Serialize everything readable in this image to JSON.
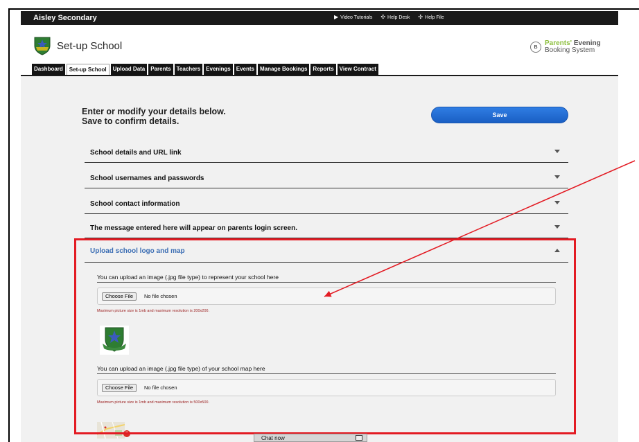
{
  "topbar": {
    "school_name": "Aisley Secondary",
    "links": [
      {
        "icon": "video-camera-icon",
        "label": "Video Tutorials"
      },
      {
        "icon": "help-desk-icon",
        "label": "Help Desk"
      },
      {
        "icon": "help-file-icon",
        "label": "Help File"
      }
    ]
  },
  "header": {
    "title": "Set-up School",
    "brand_line1_accent": "Parents'",
    "brand_line1_rest": "Evening",
    "brand_line2": "Booking System"
  },
  "tabs": [
    {
      "label": "Dashboard"
    },
    {
      "label": "Set-up School",
      "active": true
    },
    {
      "label": "Upload Data"
    },
    {
      "label": "Parents"
    },
    {
      "label": "Teachers"
    },
    {
      "label": "Evenings"
    },
    {
      "label": "Events"
    },
    {
      "label": "Manage Bookings"
    },
    {
      "label": "Reports"
    },
    {
      "label": "View Contract"
    }
  ],
  "intro": {
    "line1": "Enter or modify your details below.",
    "line2": "Save to confirm details."
  },
  "save_label": "Save",
  "accordion": [
    {
      "label": "School details and URL link",
      "expanded": false
    },
    {
      "label": "School usernames and passwords",
      "expanded": false
    },
    {
      "label": "School contact information",
      "expanded": false
    },
    {
      "label": "The message entered here will appear on parents login screen.",
      "expanded": false
    },
    {
      "label": "Upload school logo and map",
      "expanded": true
    }
  ],
  "upload": {
    "logo_label": "You can upload an image (.jpg file type) to represent your school here",
    "logo_choose": "Choose File",
    "logo_status": "No file chosen",
    "logo_note": "Maximum picture size is 1mb and maximum resolution is 200x200.",
    "map_label": "You can upload an image (.jpg file type) of your school map here",
    "map_choose": "Choose File",
    "map_status": "No file chosen",
    "map_note": "Maximum picture size is 1mb and maximum resolution is 500x500."
  },
  "chat": {
    "label": "Chat now"
  },
  "colors": {
    "annotation_red": "#e31b23",
    "save_blue": "#1a5fc4",
    "brand_green": "#8dbf3e",
    "link_blue": "#3c6eb4"
  }
}
